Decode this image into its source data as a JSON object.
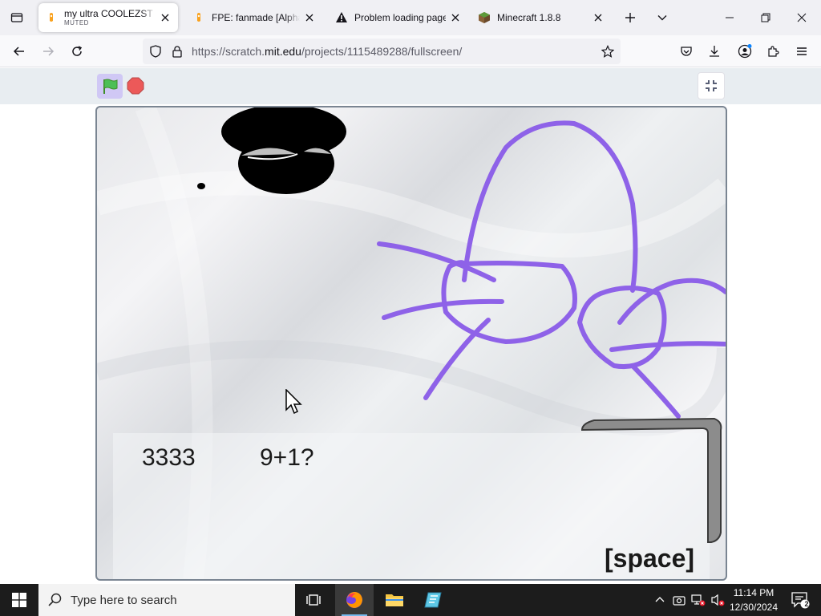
{
  "browser": {
    "tabs": [
      {
        "title": "my ultra COOLEZST game",
        "subtitle": "MUTED",
        "active": true,
        "favicon": "scratch-cat-icon"
      },
      {
        "title": "FPE: fanmade [Alpha] by",
        "active": false,
        "favicon": "scratch-cat-icon"
      },
      {
        "title": "Problem loading page",
        "active": false,
        "favicon": "warning-icon"
      },
      {
        "title": "Minecraft 1.8.8",
        "active": false,
        "favicon": "minecraft-block-icon"
      }
    ],
    "url": {
      "prefix": "https://scratch.",
      "host": "mit.edu",
      "path": "/projects/1115489288/fullscreen/"
    }
  },
  "stage": {
    "score_text": "3333",
    "question_text": "9+1?",
    "hint_text": "[space]"
  },
  "taskbar": {
    "search_placeholder": "Type here to search",
    "time": "11:14 PM",
    "date": "12/30/2024",
    "notification_count": "2"
  },
  "colors": {
    "accent_purple": "#8e62e8",
    "scratch_flag_bg": "#d0c8f5",
    "stop_red": "#ec5959",
    "taskbar_bg": "#1c1c1c"
  }
}
